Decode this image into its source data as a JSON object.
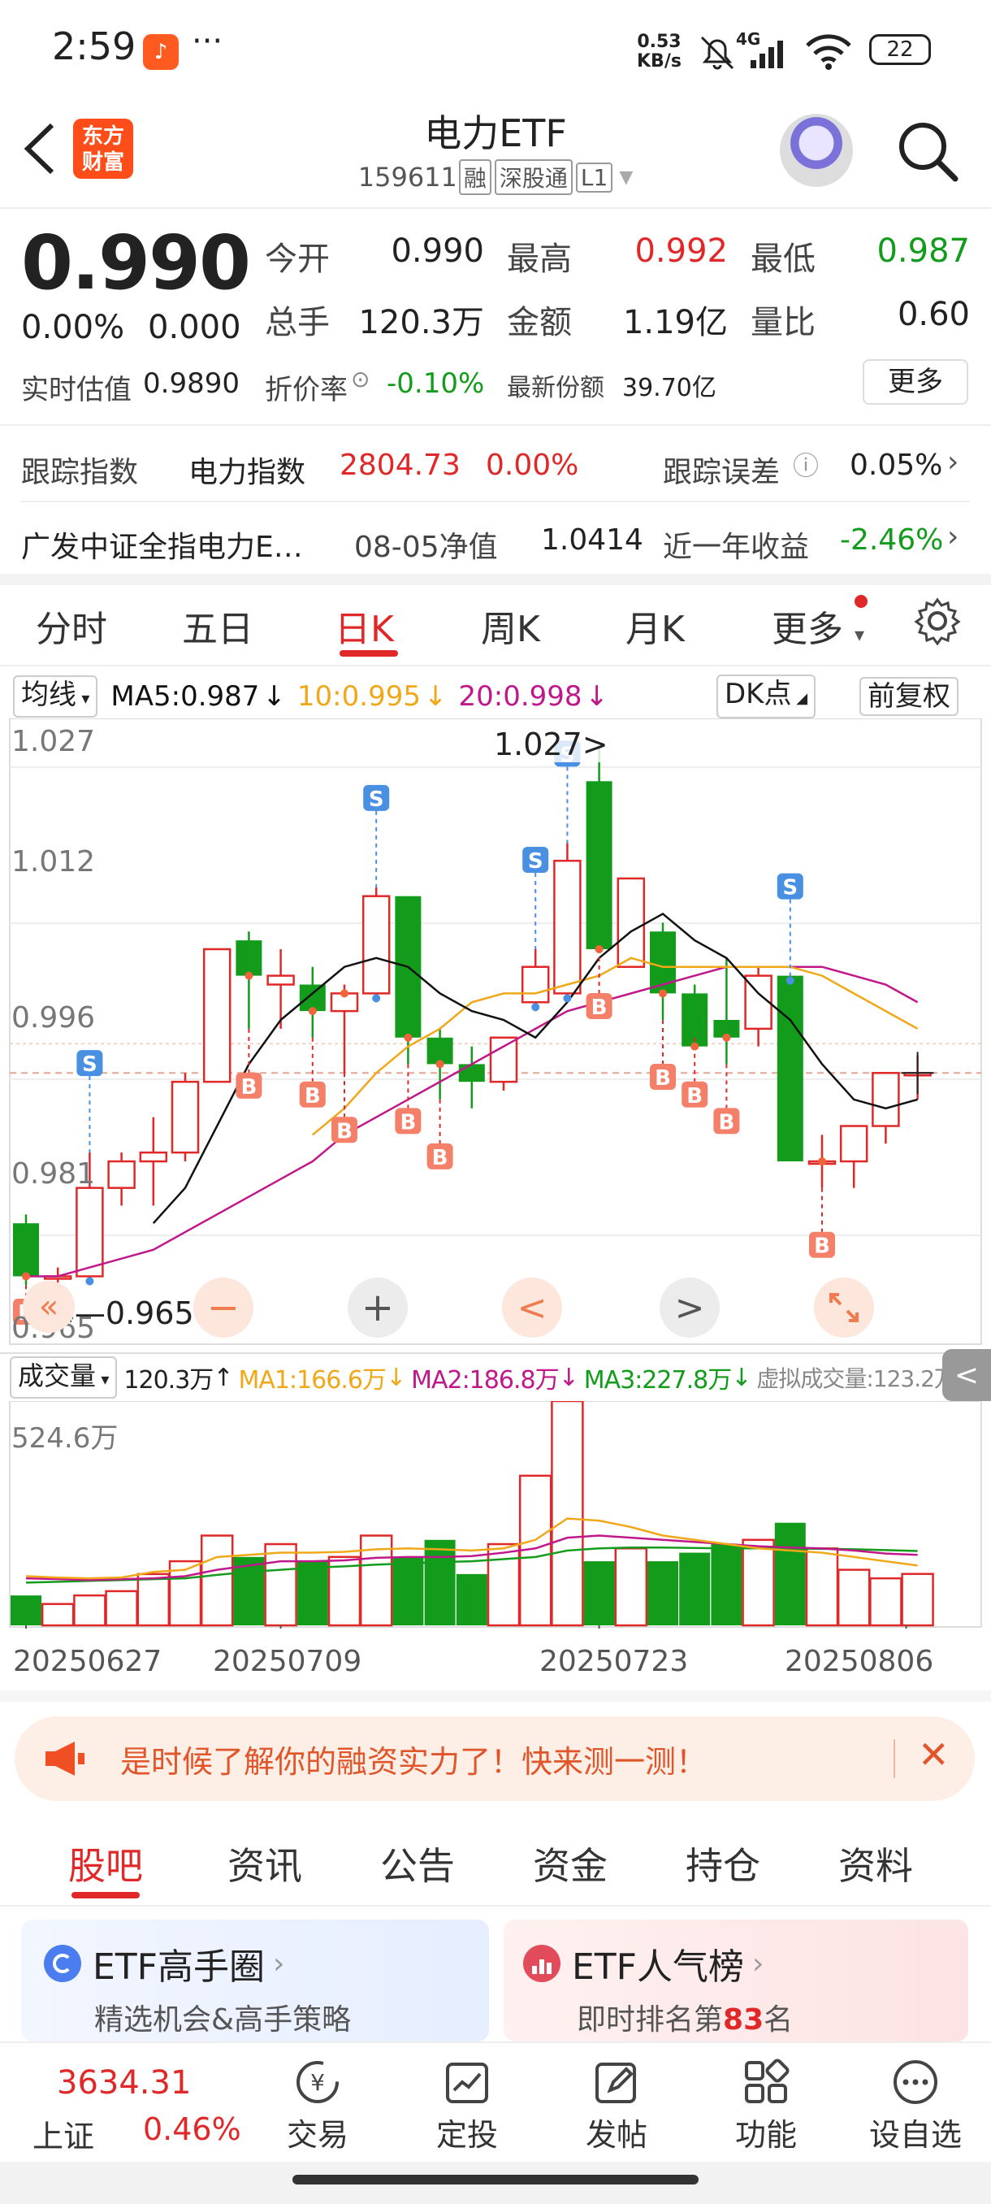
{
  "status_bar": {
    "time": "2:59",
    "app_badge": "♪",
    "dots": "···",
    "net_speed_value": "0.53",
    "net_speed_unit": "KB/s",
    "signal": "4G",
    "battery": "22"
  },
  "header": {
    "title": "电力ETF",
    "code": "159611",
    "tag1": "融",
    "tag2": "深股通",
    "tag3": "L1",
    "logo_line1": "东方",
    "logo_line2": "财富"
  },
  "quote": {
    "price": "0.990",
    "change_pct": "0.00%",
    "change_val": "0.000",
    "open_label": "今开",
    "open": "0.990",
    "high_label": "最高",
    "high": "0.992",
    "low_label": "最低",
    "low": "0.987",
    "volume_label": "总手",
    "volume": "120.3万",
    "amount_label": "金额",
    "amount": "1.19亿",
    "ratio_label": "量比",
    "ratio": "0.60",
    "est_label": "实时估值",
    "est": "0.9890",
    "premium_label": "折价率",
    "premium": "-0.10%",
    "shares_label": "最新份额",
    "shares": "39.70亿",
    "more_button": "更多"
  },
  "tracking": {
    "label": "跟踪指数",
    "index_name": "电力指数",
    "index_value": "2804.73",
    "index_change": "0.00%",
    "error_label": "跟踪误差",
    "error_value": "0.05%",
    "fund_name": "广发中证全指电力E…",
    "nav_label": "08-05净值",
    "nav_value": "1.0414",
    "yearly_label": "近一年收益",
    "yearly_value": "-2.46%"
  },
  "chart_tabs": [
    "分时",
    "五日",
    "日K",
    "周K",
    "月K",
    "更多"
  ],
  "ma_bar": {
    "selector": "均线",
    "ma5": "MA5:0.987",
    "ma10": "10:0.995",
    "ma20": "20:0.998",
    "dk_button": "DK点",
    "adjust_button": "前复权"
  },
  "price_axis": [
    "1.027",
    "1.012",
    "0.996",
    "0.981",
    "0.965"
  ],
  "annotations": {
    "high_marker": "1.027",
    "low_marker": "0.965"
  },
  "volume_bar": {
    "selector": "成交量",
    "vol": "120.3万",
    "ma1": "MA1:166.6万",
    "ma2": "MA2:186.8万",
    "ma3": "MA3:227.8万",
    "virtual": "虚拟成交量:123.2万",
    "max_label": "524.6万"
  },
  "date_axis": [
    "20250627",
    "20250709",
    "20250723",
    "20250806"
  ],
  "colors": {
    "up": "#e02828",
    "down": "#139c1c",
    "ma5": "#111111",
    "ma10": "#f0a818",
    "ma20": "#c0188a"
  },
  "chart_data": {
    "type": "candlestick",
    "ylim": [
      0.963,
      1.029
    ],
    "ohlc": [
      [
        0.973,
        0.974,
        0.966,
        0.967
      ],
      [
        0.967,
        0.968,
        0.965,
        0.967
      ],
      [
        0.967,
        0.981,
        0.966,
        0.977
      ],
      [
        0.977,
        0.981,
        0.975,
        0.98
      ],
      [
        0.98,
        0.985,
        0.975,
        0.981
      ],
      [
        0.981,
        0.99,
        0.98,
        0.989
      ],
      [
        0.989,
        1.004,
        0.992,
        1.004
      ],
      [
        1.005,
        1.006,
        0.995,
        1.001
      ],
      [
        1.0,
        1.004,
        0.995,
        1.001
      ],
      [
        1.0,
        1.002,
        0.994,
        0.997
      ],
      [
        0.997,
        1.0,
        0.99,
        0.999
      ],
      [
        0.999,
        1.011,
        0.998,
        1.01
      ],
      [
        1.01,
        1.01,
        0.991,
        0.994
      ],
      [
        0.994,
        0.995,
        0.987,
        0.991
      ],
      [
        0.991,
        0.993,
        0.986,
        0.989
      ],
      [
        0.989,
        0.994,
        0.988,
        0.994
      ],
      [
        0.998,
        1.004,
        0.997,
        1.002
      ],
      [
        0.999,
        1.016,
        0.998,
        1.014
      ],
      [
        1.023,
        1.027,
        1.004,
        1.004
      ],
      [
        1.002,
        1.012,
        1.002,
        1.012
      ],
      [
        1.006,
        1.007,
        0.996,
        0.999
      ],
      [
        0.999,
        1.0,
        0.994,
        0.993
      ],
      [
        0.996,
        1.003,
        0.991,
        0.994
      ],
      [
        0.995,
        1.002,
        0.993,
        1.001
      ],
      [
        1.001,
        1.001,
        0.98,
        0.98
      ],
      [
        0.98,
        0.983,
        0.977,
        0.98
      ],
      [
        0.98,
        0.983,
        0.977,
        0.984
      ],
      [
        0.984,
        0.99,
        0.982,
        0.99
      ],
      [
        0.99,
        0.992,
        0.987,
        0.99
      ]
    ],
    "ma5": [
      null,
      null,
      null,
      null,
      0.973,
      0.977,
      0.984,
      0.991,
      0.996,
      0.999,
      1.002,
      1.003,
      1.002,
      0.999,
      0.997,
      0.996,
      0.994,
      0.998,
      1.003,
      1.006,
      1.008,
      1.005,
      1.003,
      0.999,
      0.996,
      0.991,
      0.987,
      0.986,
      0.987
    ],
    "ma10": [
      null,
      null,
      null,
      null,
      null,
      null,
      null,
      null,
      null,
      0.983,
      0.986,
      0.99,
      0.993,
      0.995,
      0.998,
      0.999,
      0.999,
      1.0,
      1.001,
      1.003,
      1.002,
      1.002,
      1.002,
      1.002,
      1.002,
      1.001,
      0.999,
      0.997,
      0.995
    ],
    "ma20": [
      0.967,
      0.967,
      0.968,
      0.969,
      0.97,
      0.972,
      0.974,
      0.976,
      0.978,
      0.98,
      0.983,
      0.985,
      0.987,
      0.989,
      0.991,
      0.993,
      0.995,
      0.997,
      0.998,
      0.999,
      1.0,
      1.001,
      1.002,
      1.002,
      1.002,
      1.002,
      1.001,
      1.0,
      0.998
    ],
    "buy_signals": [
      0,
      7,
      9,
      10,
      12,
      13,
      18,
      20,
      21,
      22,
      25
    ],
    "sell_signals": [
      2,
      11,
      16,
      17,
      24
    ],
    "volume": [
      70,
      50,
      70,
      80,
      120,
      150,
      210,
      160,
      190,
      150,
      160,
      210,
      160,
      200,
      120,
      190,
      350,
      524.6,
      150,
      180,
      150,
      170,
      190,
      200,
      240,
      180,
      130,
      110,
      120.3
    ],
    "vol_ma1": [
      115,
      112,
      110,
      112,
      125,
      130,
      160,
      165,
      170,
      170,
      172,
      178,
      180,
      178,
      175,
      180,
      200,
      250,
      245,
      230,
      210,
      200,
      190,
      180,
      175,
      170,
      160,
      150,
      140
    ],
    "vol_ma2": [
      110,
      108,
      106,
      108,
      110,
      115,
      130,
      140,
      150,
      150,
      152,
      158,
      160,
      160,
      162,
      170,
      180,
      205,
      210,
      205,
      200,
      195,
      190,
      185,
      182,
      180,
      175,
      168,
      165
    ],
    "vol_ma3": [
      100,
      102,
      104,
      106,
      108,
      110,
      118,
      125,
      130,
      135,
      138,
      142,
      145,
      148,
      150,
      155,
      160,
      175,
      180,
      182,
      182,
      181,
      180,
      180,
      180,
      179,
      178,
      176,
      174
    ]
  },
  "chart_controls": {
    "minus": "−",
    "plus": "+",
    "prev": "<",
    "next": ">"
  },
  "ad_banner": {
    "text": "是时候了解你的融资实力了！快来测一测！",
    "close": "✕"
  },
  "sub_tabs": [
    "股吧",
    "资讯",
    "公告",
    "资金",
    "持仓",
    "资料"
  ],
  "cards": {
    "left_title": "ETF高手圈",
    "left_sub": "精选机会&高手策略",
    "right_title": "ETF人气榜",
    "right_sub_prefix": "即时排名第",
    "right_rank": "83",
    "right_sub_suffix": "名"
  },
  "bottom_nav": {
    "index_value": "3634.31",
    "index_name": "上证",
    "index_change": "0.46%",
    "items": [
      "交易",
      "定投",
      "发帖",
      "功能",
      "设自选"
    ]
  }
}
